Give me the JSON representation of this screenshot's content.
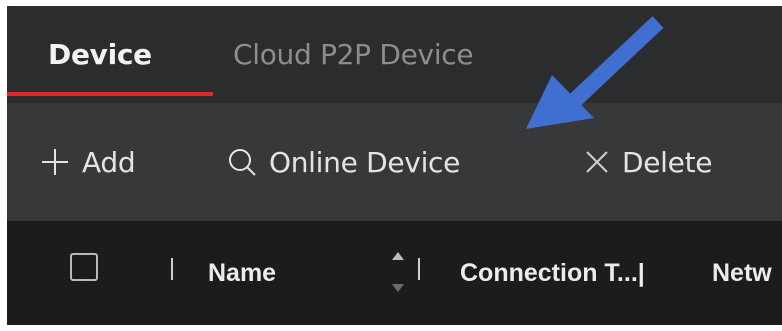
{
  "tabs": [
    {
      "label": "Device",
      "active": true
    },
    {
      "label": "Cloud P2P Device",
      "active": false
    }
  ],
  "toolbar": {
    "add_label": "Add",
    "online_label": "Online Device",
    "delete_label": "Delete"
  },
  "table": {
    "columns": [
      "Name",
      "Connection T...|",
      "Netw"
    ]
  },
  "icons": {
    "add": "plus-icon",
    "online": "search-icon",
    "delete": "close-icon",
    "sort": "sort-icon",
    "annotation": "arrow-icon"
  },
  "colors": {
    "tab_bar_bg": "#2b2c2e",
    "toolbar_bg": "#373839",
    "header_bg": "#1b1c1e",
    "active_tab_indicator": "#e0282a",
    "annotation_arrow": "#3f6fd1"
  }
}
